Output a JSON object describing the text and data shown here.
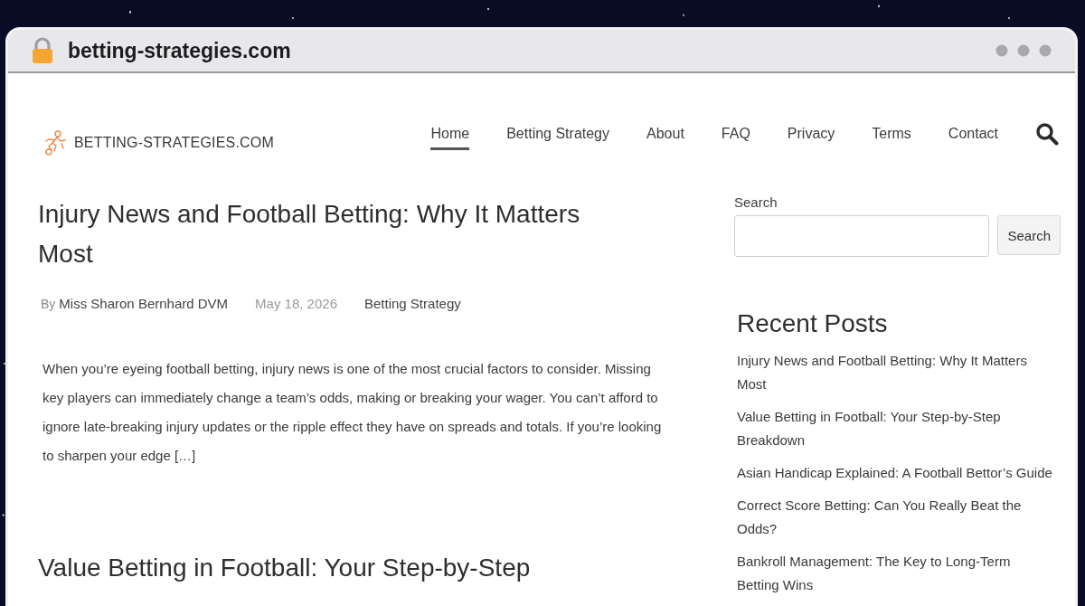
{
  "browser": {
    "url": "betting-strategies.com"
  },
  "site": {
    "logo_text": "BETTING-STRATEGIES.COM"
  },
  "nav": [
    {
      "label": "Home",
      "selected": true
    },
    {
      "label": "Betting Strategy",
      "selected": false
    },
    {
      "label": "About",
      "selected": false
    },
    {
      "label": "FAQ",
      "selected": false
    },
    {
      "label": "Privacy",
      "selected": false
    },
    {
      "label": "Terms",
      "selected": false
    },
    {
      "label": "Contact",
      "selected": false
    }
  ],
  "posts": [
    {
      "title": "Injury News and Football Betting: Why It Matters Most",
      "meta": {
        "by": "By",
        "author": "Miss Sharon Bernhard DVM",
        "date": "May 18, 2026",
        "category": "Betting Strategy"
      },
      "excerpt": "When you’re eyeing football betting, injury news is one of the most crucial factors to consider. Missing key players can immediately change a team’s odds, making or breaking your wager. You can’t afford to ignore late-breaking injury updates or the ripple effect they have on spreads and totals. If you’re looking to sharpen your edge […]"
    },
    {
      "title": "Value Betting in Football: Your Step-by-Step"
    }
  ],
  "sidebar": {
    "search": {
      "label": "Search",
      "button": "Search"
    },
    "recent_posts": {
      "title": "Recent Posts",
      "items": [
        "Injury News and Football Betting: Why It Matters Most",
        "Value Betting in Football: Your Step-by-Step Breakdown",
        "Asian Handicap Explained: A Football Bettor’s Guide",
        "Correct Score Betting: Can You Really Beat the Odds?",
        "Bankroll Management: The Key to Long-Term Betting Wins"
      ]
    }
  }
}
